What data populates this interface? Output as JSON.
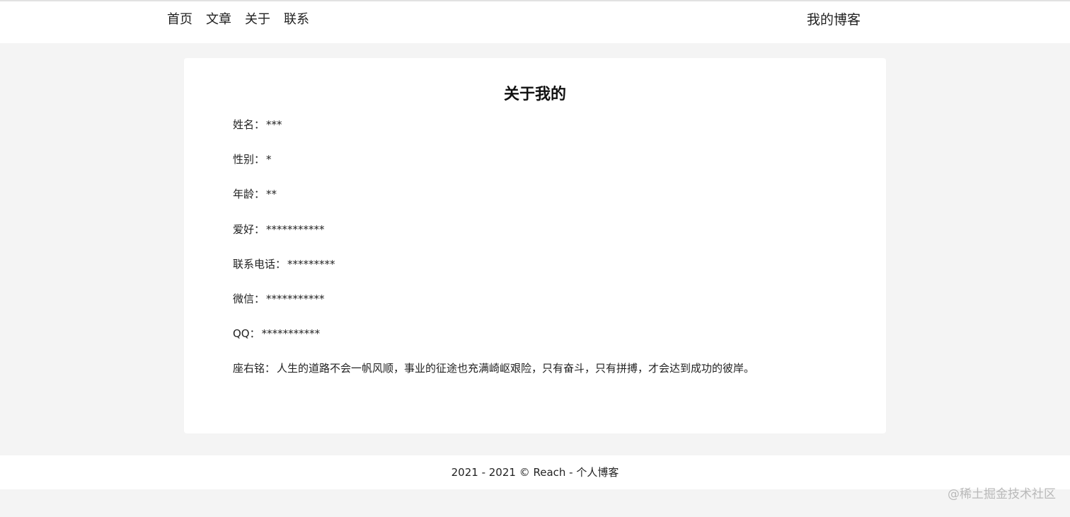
{
  "nav": {
    "links": [
      "首页",
      "文章",
      "关于",
      "联系"
    ],
    "brand": "我的博客"
  },
  "about": {
    "title": "关于我的",
    "items": [
      {
        "label": "姓名",
        "value": "***"
      },
      {
        "label": "性别",
        "value": "*"
      },
      {
        "label": "年龄",
        "value": "**"
      },
      {
        "label": "爱好",
        "value": "***********"
      },
      {
        "label": "联系电话",
        "value": "*********"
      },
      {
        "label": "微信",
        "value": "***********"
      },
      {
        "label": "QQ",
        "value": "***********"
      },
      {
        "label": "座右铭",
        "value": "人生的道路不会一帆风顺，事业的征途也充满崎岖艰险，只有奋斗，只有拼搏，才会达到成功的彼岸。"
      }
    ],
    "separator": "："
  },
  "footer": {
    "text": "2021 - 2021 © Reach - 个人博客"
  },
  "watermark": "@稀土掘金技术社区",
  "colors": {
    "page_background": "#f4f4f4",
    "panel_background": "#ffffff",
    "text": "#222222",
    "watermark": "#b9b9b9"
  }
}
